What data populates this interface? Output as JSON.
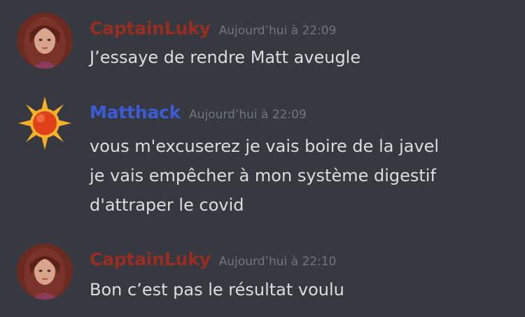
{
  "colors": {
    "background": "#36393f",
    "text": "#dcddde",
    "timestamp": "#72767d"
  },
  "messages": [
    {
      "author": "CaptainLuky",
      "author_color": "#9b2d20",
      "avatar": "portrait-avatar",
      "timestamp": "Aujourd’hui à 22:09",
      "lines": [
        "J’essaye de rendre Matt aveugle"
      ]
    },
    {
      "author": "Matthack",
      "author_color": "#3c5bd6",
      "avatar": "sun-avatar",
      "timestamp": "Aujourd’hui à 22:09",
      "lines": [
        "vous m'excuserez je vais boire de la javel",
        "je vais empêcher à mon système digestif",
        "d'attraper le covid"
      ]
    },
    {
      "author": "CaptainLuky",
      "author_color": "#9b2d20",
      "avatar": "portrait-avatar",
      "timestamp": "Aujourd’hui à 22:10",
      "lines": [
        "Bon c’est pas le résultat voulu"
      ]
    }
  ]
}
